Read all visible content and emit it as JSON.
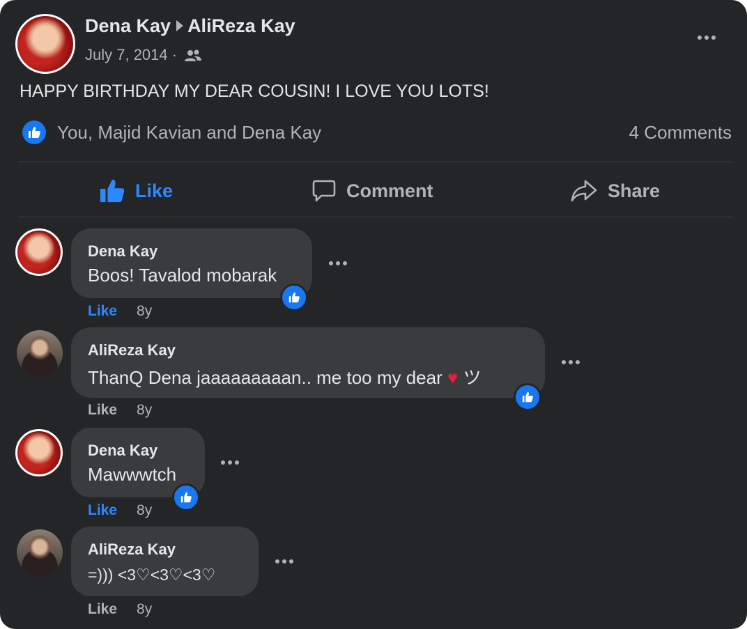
{
  "post": {
    "author": "Dena Kay",
    "recipient": "AliReza Kay",
    "date": "July 7, 2014 ·",
    "audience_icon": "friends-icon",
    "text": "HAPPY BIRTHDAY MY DEAR COUSIN! I LOVE YOU LOTS!",
    "reactions_text": "You, Majid Kavian and Dena Kay",
    "comments_count": "4 Comments"
  },
  "actions": {
    "like": "Like",
    "comment": "Comment",
    "share": "Share"
  },
  "comments": [
    {
      "author": "Dena Kay",
      "text": "Boos! Tavalod mobarak",
      "like": "Like",
      "age": "8y",
      "liked_by_you": true
    },
    {
      "author": "AliReza Kay",
      "text_before": "ThanQ Dena jaaaaaaaaan.. me too my dear",
      "heart": "♥",
      "text_after": "ツ",
      "like": "Like",
      "age": "8y",
      "liked_by_you": false
    },
    {
      "author": "Dena Kay",
      "text": "Mawwwtch",
      "like": "Like",
      "age": "8y",
      "liked_by_you": true
    },
    {
      "author": "AliReza Kay",
      "text": "=))) <3♡<3♡<3♡",
      "like": "Like",
      "age": "8y",
      "liked_by_you": false
    }
  ],
  "colors": {
    "background": "#242526",
    "bubble": "#3a3b3c",
    "accent": "#2d88ff",
    "badge": "#1877f2",
    "text": "#e4e6eb",
    "muted": "#b0b3b8"
  }
}
